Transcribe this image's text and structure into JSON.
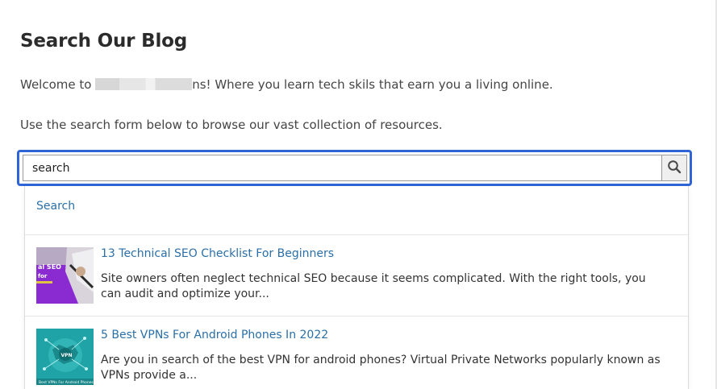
{
  "page": {
    "title": "Search Our Blog",
    "intro_before": "Welcome to ",
    "intro_after": "ns! Where you learn tech skils that earn you a living online.",
    "instructions": "Use the search form below to browse our vast collection of resources."
  },
  "search": {
    "value": "search",
    "button_icon": "search-icon"
  },
  "dropdown": {
    "search_link": "Search",
    "results": [
      {
        "title": "13 Technical SEO Checklist For Beginners",
        "excerpt": "Site owners often neglect technical SEO because it seems complicated. With the right tools, you can audit and optimize your...",
        "thumb_text": "al SEO\nfor"
      },
      {
        "title": "5 Best VPNs For Android Phones In 2022",
        "excerpt": "Are you in search of the best VPN for android phones? Virtual Private Networks popularly known as VPNs provide a...",
        "thumb_text": "Best VPNs For Android Phones"
      }
    ]
  },
  "colors": {
    "accent_border": "#2f64d4",
    "link": "#2a6fa8",
    "thumb1_bg": "#8a2bd1",
    "thumb2_bg": "#1fa3a6"
  }
}
